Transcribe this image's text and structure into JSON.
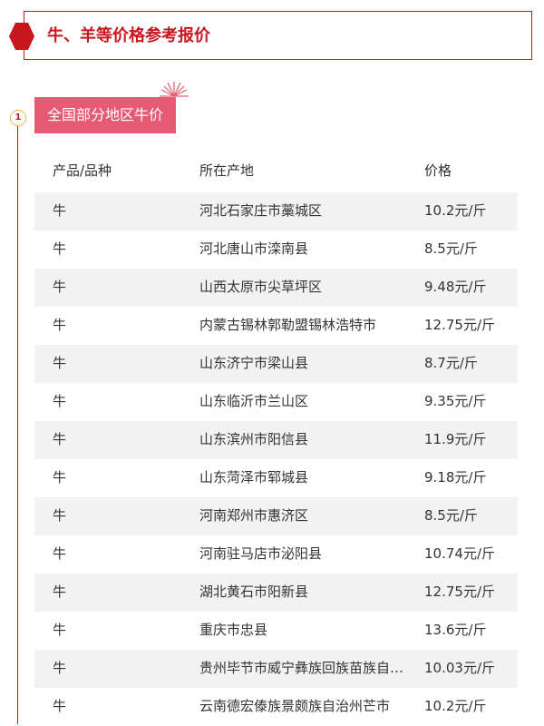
{
  "header": {
    "title": "牛、羊等价格参考报价"
  },
  "section": {
    "step": "1",
    "label": "全国部分地区牛价"
  },
  "table": {
    "columns": [
      "产品/品种",
      "所在产地",
      "价格"
    ],
    "rows": [
      [
        "牛",
        "河北石家庄市藁城区",
        "10.2元/斤"
      ],
      [
        "牛",
        "河北唐山市滦南县",
        "8.5元/斤"
      ],
      [
        "牛",
        "山西太原市尖草坪区",
        "9.48元/斤"
      ],
      [
        "牛",
        "内蒙古锡林郭勒盟锡林浩特市",
        "12.75元/斤"
      ],
      [
        "牛",
        "山东济宁市梁山县",
        "8.7元/斤"
      ],
      [
        "牛",
        "山东临沂市兰山区",
        "9.35元/斤"
      ],
      [
        "牛",
        "山东滨州市阳信县",
        "11.9元/斤"
      ],
      [
        "牛",
        "山东菏泽市郓城县",
        "9.18元/斤"
      ],
      [
        "牛",
        "河南郑州市惠济区",
        "8.5元/斤"
      ],
      [
        "牛",
        "河南驻马店市泌阳县",
        "10.74元/斤"
      ],
      [
        "牛",
        "湖北黄石市阳新县",
        "12.75元/斤"
      ],
      [
        "牛",
        "重庆市忠县",
        "13.6元/斤"
      ],
      [
        "牛",
        "贵州毕节市威宁彝族回族苗族自…",
        "10.03元/斤"
      ],
      [
        "牛",
        "云南德宏傣族景颇族自治州芒市",
        "10.2元/斤"
      ]
    ]
  },
  "colors": {
    "accent": "#c8161d",
    "label_bg": "#e75a73",
    "row_shade": "#f2f2f2"
  }
}
